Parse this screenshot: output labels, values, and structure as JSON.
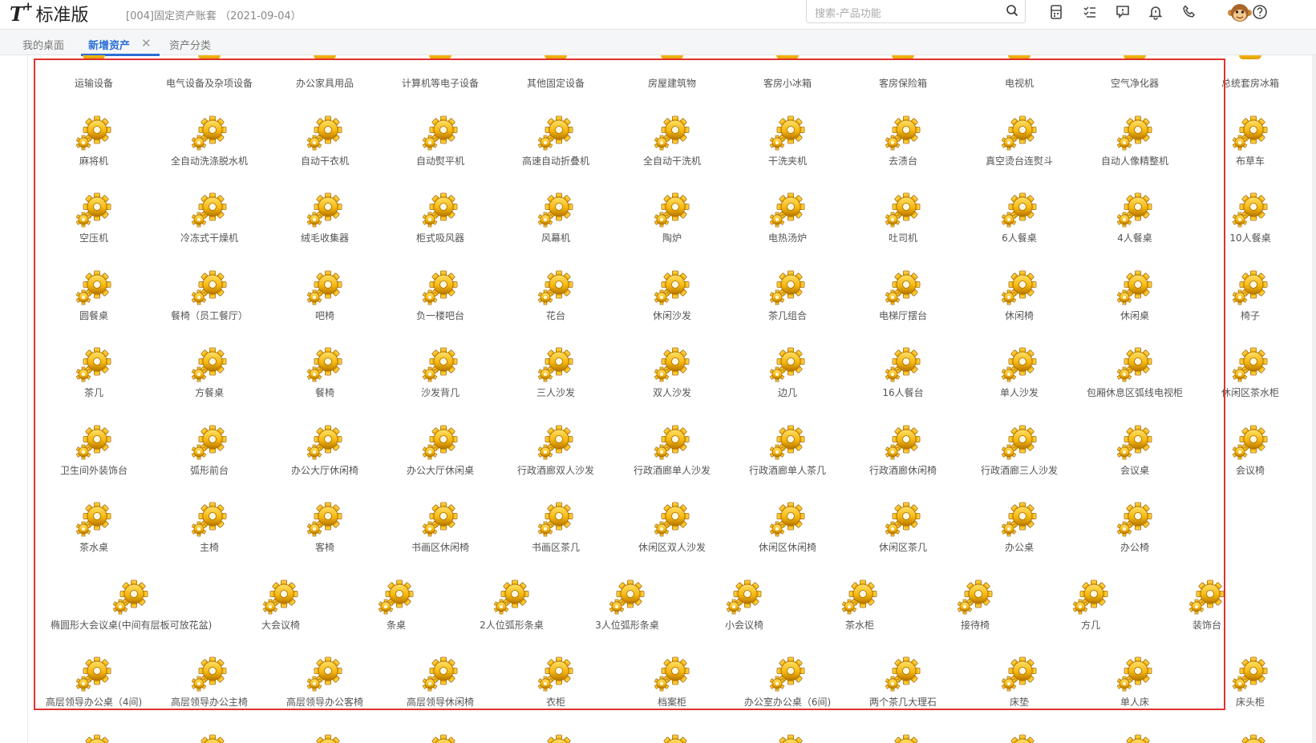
{
  "app": {
    "logo_text": "T+",
    "edition": "标准版",
    "account": "[004]固定资产账套 （2021-09-04）"
  },
  "search": {
    "placeholder": "搜索-产品功能"
  },
  "toolbar_icons": [
    "calculator-icon",
    "task-list-icon",
    "message-icon",
    "notification-bell-icon",
    "phone-icon",
    "avatar-monkey-icon",
    "help-icon"
  ],
  "tabs": [
    {
      "label": "我的桌面",
      "active": false
    },
    {
      "label": "新增资产",
      "active": true,
      "closable": true
    },
    {
      "label": "资产分类",
      "active": false
    }
  ],
  "tab_close": "✕",
  "rows": [
    [
      "运输设备",
      "电气设备及杂项设备",
      "办公家具用品",
      "计算机等电子设备",
      "其他固定设备",
      "房屋建筑物",
      "客房小冰箱",
      "客房保险箱",
      "电视机",
      "空气净化器",
      "总统套房冰箱"
    ],
    [
      "麻将机",
      "全自动洗涤脱水机",
      "自动干衣机",
      "自动熨平机",
      "高速自动折叠机",
      "全自动干洗机",
      "干洗夹机",
      "去渍台",
      "真空烫台连熨斗",
      "自动人像精整机",
      "布草车"
    ],
    [
      "空压机",
      "冷冻式干燥机",
      "绒毛收集器",
      "柜式吸风器",
      "风幕机",
      "陶炉",
      "电热汤炉",
      "吐司机",
      "6人餐桌",
      "4人餐桌",
      "10人餐桌"
    ],
    [
      "圆餐桌",
      "餐椅（员工餐厅）",
      "吧椅",
      "负一楼吧台",
      "花台",
      "休闲沙发",
      "茶几组合",
      "电梯厅摆台",
      "休闲椅",
      "休闲桌",
      "椅子"
    ],
    [
      "茶几",
      "方餐桌",
      "餐椅",
      "沙发背几",
      "三人沙发",
      "双人沙发",
      "边几",
      "16人餐台",
      "单人沙发",
      "包厢休息区弧线电视柜",
      "休闲区茶水柜"
    ],
    [
      "卫生间外装饰台",
      "弧形前台",
      "办公大厅休闲椅",
      "办公大厅休闲桌",
      "行政酒廊双人沙发",
      "行政酒廊单人沙发",
      "行政酒廊单人茶几",
      "行政酒廊休闲椅",
      "行政酒廊三人沙发",
      "会议桌",
      "会议椅"
    ],
    [
      "茶水桌",
      "主椅",
      "客椅",
      "书画区休闲椅",
      "书画区茶几",
      "休闲区双人沙发",
      "休闲区休闲椅",
      "休闲区茶几",
      "办公桌",
      "办公椅"
    ],
    [
      "椭圆形大会议桌(中间有层板可放花盆)",
      "大会议椅",
      "条桌",
      "2人位弧形条桌",
      "3人位弧形条桌",
      "小会议椅",
      "茶水柜",
      "接待椅",
      "方几",
      "装饰台"
    ],
    [
      "高层领导办公桌（4间)",
      "高层领导办公主椅",
      "高层领导办公客椅",
      "高层领导休闲椅",
      "衣柜",
      "档案柜",
      "办公室办公桌（6间)",
      "两个茶几大理石",
      "床垫",
      "单人床",
      "床头柜"
    ]
  ]
}
